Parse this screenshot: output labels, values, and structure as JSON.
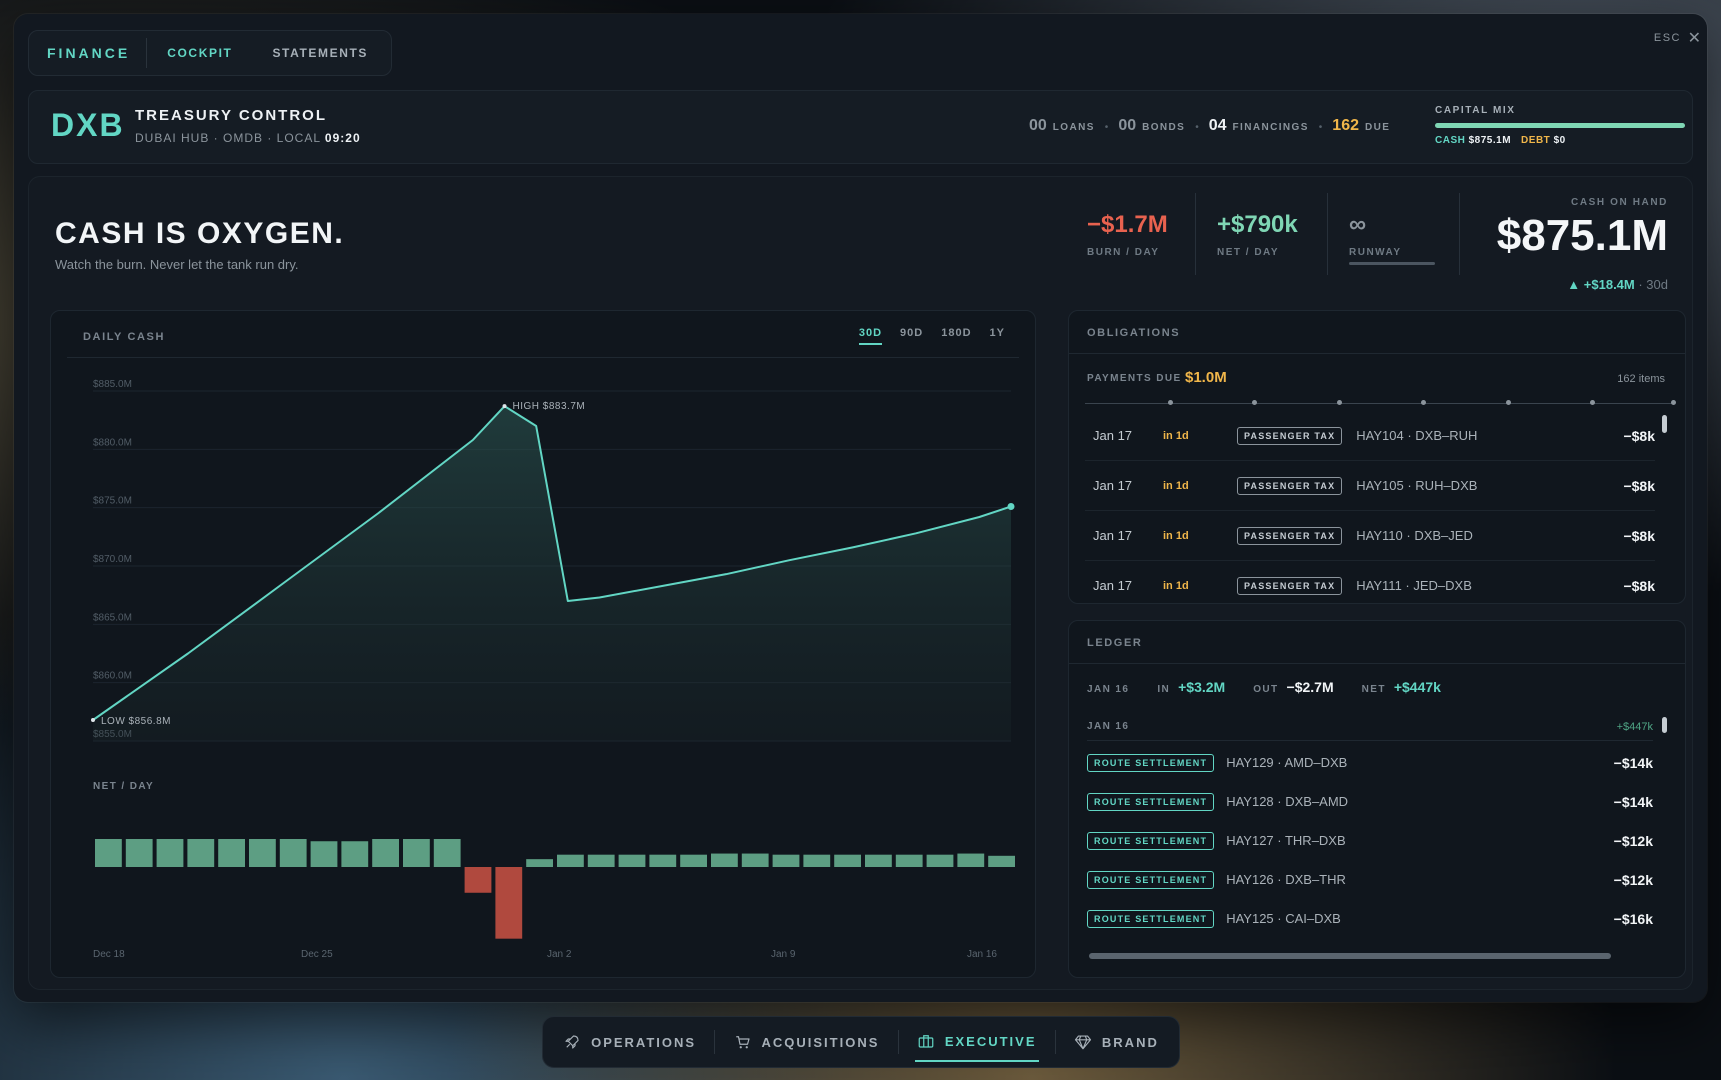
{
  "window": {
    "esc_label": "ESC",
    "close_glyph": "✕"
  },
  "tabs": {
    "brand": "FINANCE",
    "items": [
      "COCKPIT",
      "STATEMENTS"
    ],
    "active": "COCKPIT"
  },
  "header": {
    "code": "DXB",
    "title": "TREASURY CONTROL",
    "sub_prefix": "DUBAI HUB · OMDB · LOCAL ",
    "local_time": "09:20",
    "counts": [
      {
        "n": "00",
        "label": "LOANS"
      },
      {
        "n": "00",
        "label": "BONDS"
      },
      {
        "n": "04",
        "label": "FINANCINGS"
      },
      {
        "n": "162",
        "label": "DUE"
      }
    ],
    "capital_mix": {
      "label": "CAPITAL MIX",
      "cash_label": "CASH",
      "cash": "$875.1M",
      "debt_label": "DEBT",
      "debt": "$0",
      "cash_fraction": 1.0
    }
  },
  "hero": {
    "title": "CASH IS OXYGEN.",
    "subtitle": "Watch the burn. Never let the tank run dry."
  },
  "stats": {
    "burn": {
      "value": "−$1.7M",
      "label": "BURN / DAY"
    },
    "net": {
      "value": "+$790k",
      "label": "NET / DAY"
    },
    "runway": {
      "value": "∞",
      "label": "RUNWAY"
    },
    "cash_on_hand": {
      "label": "CASH ON HAND",
      "value": "$875.1M",
      "delta": "+$18.4M",
      "period": "· 30d"
    }
  },
  "colors": {
    "accent": "#62d6c4",
    "warning": "#f0b64a",
    "negative": "#e8624f",
    "bar_positive": "#5d9e83",
    "bar_negative": "#b0493e"
  },
  "chart_panel": {
    "label": "DAILY CASH",
    "ranges": [
      "30D",
      "90D",
      "180D",
      "1Y"
    ],
    "active_range": "30D"
  },
  "chart_data": [
    {
      "type": "area",
      "title": "DAILY CASH",
      "y_unit": "$M",
      "ylim": [
        855,
        885
      ],
      "y_ticks": [
        885,
        880,
        875,
        870,
        865,
        860,
        855
      ],
      "y_tick_labels": [
        "$885.0M",
        "$880.0M",
        "$875.0M",
        "$870.0M",
        "$865.0M",
        "$860.0M",
        "$855.0M"
      ],
      "x_labels": [
        "Dec 18",
        "Dec 25",
        "Jan 2",
        "Jan 9",
        "Jan 16"
      ],
      "x": [
        0,
        3,
        6,
        9,
        12,
        13,
        14,
        15,
        16,
        18,
        20,
        22,
        24,
        26,
        28,
        29
      ],
      "values": [
        856.8,
        862.5,
        868.5,
        874.5,
        880.8,
        883.7,
        882.0,
        867.0,
        867.3,
        868.3,
        869.3,
        870.5,
        871.6,
        872.8,
        874.2,
        875.1
      ],
      "annotations": [
        {
          "label": "HIGH $883.7M",
          "x": 13,
          "y": 883.7
        },
        {
          "label": "LOW $856.8M",
          "x": 0,
          "y": 856.8
        }
      ],
      "grid": true
    },
    {
      "type": "bar",
      "title": "NET / DAY",
      "y_unit": "$k",
      "x_labels": [
        "Dec 18",
        "Dec 25",
        "Jan 2",
        "Jan 9",
        "Jan 16"
      ],
      "values": [
        1250,
        1250,
        1250,
        1250,
        1250,
        1250,
        1250,
        1150,
        1150,
        1250,
        1250,
        1250,
        -1150,
        -3200,
        350,
        550,
        550,
        550,
        550,
        550,
        600,
        600,
        550,
        550,
        550,
        550,
        550,
        550,
        600,
        500
      ]
    }
  ],
  "obligations": {
    "label": "OBLIGATIONS",
    "payments_due_label": "PAYMENTS DUE",
    "payments_due": "$1.0M",
    "items_count": "162 items",
    "rows": [
      {
        "date": "Jan 17",
        "in": "in 1d",
        "tag": "PASSENGER TAX",
        "desc": "HAY104 · DXB–RUH",
        "amount": "−$8k"
      },
      {
        "date": "Jan 17",
        "in": "in 1d",
        "tag": "PASSENGER TAX",
        "desc": "HAY105 · RUH–DXB",
        "amount": "−$8k"
      },
      {
        "date": "Jan 17",
        "in": "in 1d",
        "tag": "PASSENGER TAX",
        "desc": "HAY110 · DXB–JED",
        "amount": "−$8k"
      },
      {
        "date": "Jan 17",
        "in": "in 1d",
        "tag": "PASSENGER TAX",
        "desc": "HAY111 · JED–DXB",
        "amount": "−$8k"
      }
    ]
  },
  "ledger": {
    "label": "LEDGER",
    "day": "JAN 16",
    "in_label": "IN",
    "in": "+$3.2M",
    "out_label": "OUT",
    "out": "−$2.7M",
    "net_label": "NET",
    "net": "+$447k",
    "day_header": "JAN 16",
    "day_net": "+$447k",
    "rows": [
      {
        "tag": "ROUTE SETTLEMENT",
        "desc": "HAY129 · AMD–DXB",
        "amount": "−$14k"
      },
      {
        "tag": "ROUTE SETTLEMENT",
        "desc": "HAY128 · DXB–AMD",
        "amount": "−$14k"
      },
      {
        "tag": "ROUTE SETTLEMENT",
        "desc": "HAY127 · THR–DXB",
        "amount": "−$12k"
      },
      {
        "tag": "ROUTE SETTLEMENT",
        "desc": "HAY126 · DXB–THR",
        "amount": "−$12k"
      },
      {
        "tag": "ROUTE SETTLEMENT",
        "desc": "HAY125 · CAI–DXB",
        "amount": "−$16k"
      }
    ]
  },
  "nav": {
    "items": [
      {
        "label": "OPERATIONS",
        "icon": "rocket-icon"
      },
      {
        "label": "ACQUISITIONS",
        "icon": "cart-icon"
      },
      {
        "label": "EXECUTIVE",
        "icon": "briefcase-icon"
      },
      {
        "label": "BRAND",
        "icon": "diamond-icon"
      }
    ],
    "active": "EXECUTIVE"
  }
}
